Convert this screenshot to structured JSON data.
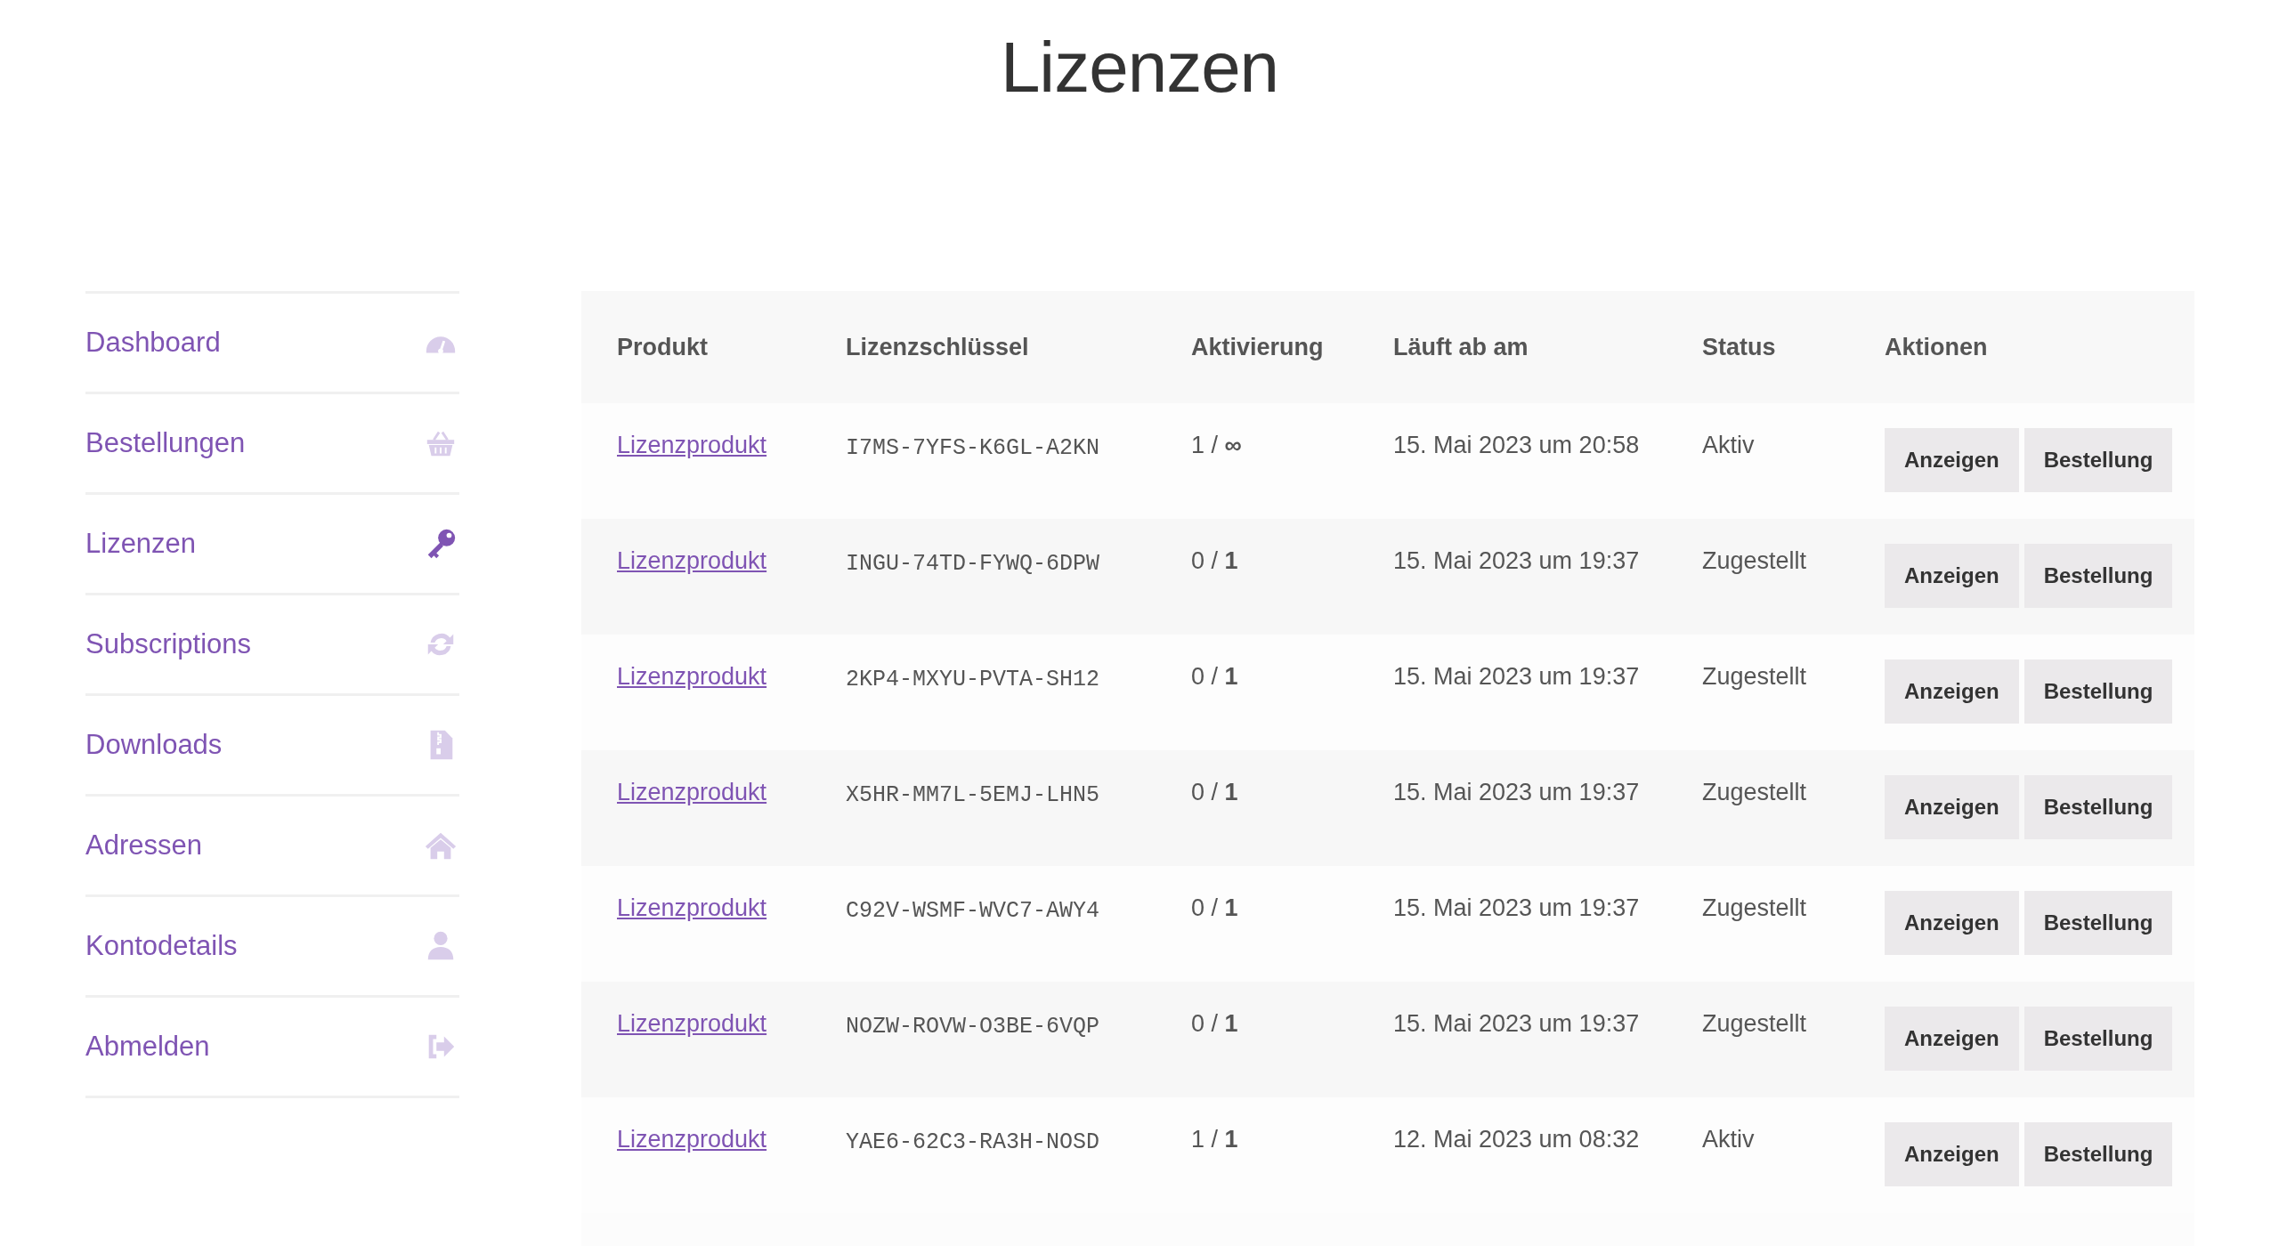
{
  "page_title": "Lizenzen",
  "nav": [
    {
      "label": "Dashboard",
      "selected": false
    },
    {
      "label": "Bestellungen",
      "selected": false
    },
    {
      "label": "Lizenzen",
      "selected": true
    },
    {
      "label": "Subscriptions",
      "selected": false
    },
    {
      "label": "Downloads",
      "selected": false
    },
    {
      "label": "Adressen",
      "selected": false
    },
    {
      "label": "Kontodetails",
      "selected": false
    },
    {
      "label": "Abmelden",
      "selected": false
    }
  ],
  "table": {
    "columns": [
      "Produkt",
      "Lizenzschlüssel",
      "Aktivierung",
      "Läuft ab am",
      "Status",
      "Aktionen"
    ],
    "rows": [
      {
        "product": "Lizenzprodukt",
        "key": "I7MS-7YFS-K6GL-A2KN",
        "activation": "1 / **∞**",
        "expires": "15. Mai 2023 um 20:58",
        "status": "Aktiv",
        "actions": [
          "Anzeigen",
          "Bestellung"
        ]
      },
      {
        "product": "Lizenzprodukt",
        "key": "INGU-74TD-FYWQ-6DPW",
        "activation": "0 / **1**",
        "expires": "15. Mai 2023 um 19:37",
        "status": "Zugestellt",
        "actions": [
          "Anzeigen",
          "Bestellung"
        ]
      },
      {
        "product": "Lizenzprodukt",
        "key": "2KP4-MXYU-PVTA-SH12",
        "activation": "0 / **1**",
        "expires": "15. Mai 2023 um 19:37",
        "status": "Zugestellt",
        "actions": [
          "Anzeigen",
          "Bestellung"
        ]
      },
      {
        "product": "Lizenzprodukt",
        "key": "X5HR-MM7L-5EMJ-LHN5",
        "activation": "0 / **1**",
        "expires": "15. Mai 2023 um 19:37",
        "status": "Zugestellt",
        "actions": [
          "Anzeigen",
          "Bestellung"
        ]
      },
      {
        "product": "Lizenzprodukt",
        "key": "C92V-WSMF-WVC7-AWY4",
        "activation": "0 / **1**",
        "expires": "15. Mai 2023 um 19:37",
        "status": "Zugestellt",
        "actions": [
          "Anzeigen",
          "Bestellung"
        ]
      },
      {
        "product": "Lizenzprodukt",
        "key": "NOZW-ROVW-O3BE-6VQP",
        "activation": "0 / **1**",
        "expires": "15. Mai 2023 um 19:37",
        "status": "Zugestellt",
        "actions": [
          "Anzeigen",
          "Bestellung"
        ]
      },
      {
        "product": "Lizenzprodukt",
        "key": "YAE6-62C3-RA3H-NOSD",
        "activation": "1 / **1**",
        "expires": "12. Mai 2023 um 08:32",
        "status": "Aktiv",
        "actions": [
          "Anzeigen",
          "Bestellung"
        ]
      }
    ]
  }
}
